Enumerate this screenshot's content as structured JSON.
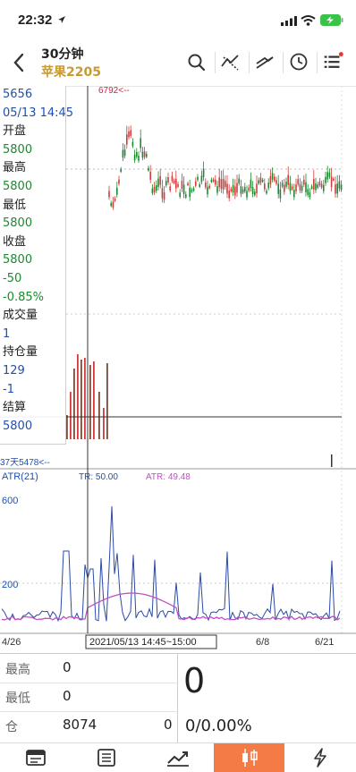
{
  "status_bar": {
    "time": "22:32"
  },
  "header": {
    "title": "30分钟",
    "subtitle": "苹果2205"
  },
  "info_panel": [
    {
      "text": "5656",
      "style": "blue"
    },
    {
      "text": "05/13 14:45",
      "style": "blue"
    },
    {
      "text": "开盘",
      "style": "lbl"
    },
    {
      "text": "5800",
      "style": "green"
    },
    {
      "text": "最高",
      "style": "lbl"
    },
    {
      "text": "5800",
      "style": "green"
    },
    {
      "text": "最低",
      "style": "lbl"
    },
    {
      "text": "5800",
      "style": "green"
    },
    {
      "text": "收盘",
      "style": "lbl"
    },
    {
      "text": "5800",
      "style": "green"
    },
    {
      "text": "-50",
      "style": "green"
    },
    {
      "text": "-0.85%",
      "style": "green"
    },
    {
      "text": "成交量",
      "style": "lbl"
    },
    {
      "text": "1",
      "style": "blue"
    },
    {
      "text": "持仓量",
      "style": "lbl"
    },
    {
      "text": "129",
      "style": "blue"
    },
    {
      "text": "-1",
      "style": "blue"
    },
    {
      "text": "结算",
      "style": "lbl"
    },
    {
      "text": "5800",
      "style": "blue"
    }
  ],
  "chart": {
    "high_marker": "6792<--",
    "low_marker": "37天5478<--",
    "atr_title": "ATR(21)",
    "tr_label": "TR: 50.00",
    "atr_label": "ATR: 49.48",
    "atr_ticks": [
      "600",
      "200"
    ],
    "x_ticks": [
      "4/26",
      "6/8",
      "6/21"
    ],
    "crosshair_time": "2021/05/13 14:45~15:00",
    "colors": {
      "up": "#d23b3b",
      "down": "#1a8a2e",
      "tr": "#2a4aa8",
      "atr": "#c04fc4",
      "crosshair": "#333333"
    }
  },
  "quote": {
    "high_label": "最高",
    "high_value": "0",
    "low_label": "最低",
    "low_value": "0",
    "oi_label": "仓",
    "oi_value": "8074",
    "oi_change": "0",
    "last_price": "0",
    "change_text": "0/0.00%"
  },
  "tabs": [
    {
      "icon": "news-icon"
    },
    {
      "icon": "list-icon"
    },
    {
      "icon": "trend-chart-icon"
    },
    {
      "icon": "candlestick-icon",
      "active": true
    },
    {
      "icon": "flash-icon"
    }
  ]
}
